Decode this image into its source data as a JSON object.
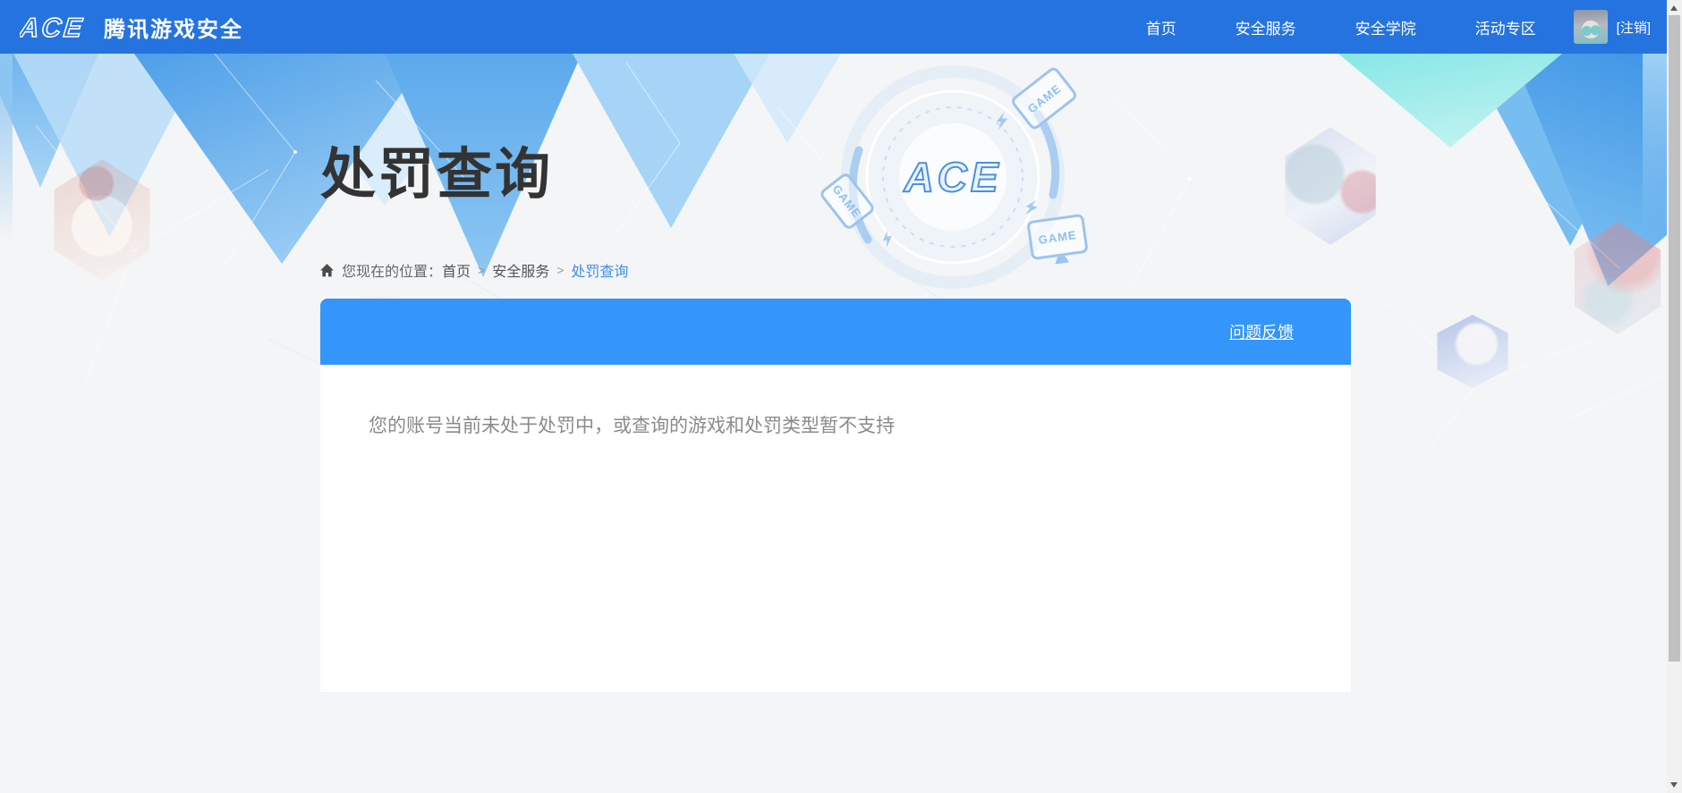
{
  "navbar": {
    "brand": {
      "logo_text": "ACE",
      "name": "腾讯游戏安全"
    },
    "items": [
      {
        "label": "首页"
      },
      {
        "label": "安全服务"
      },
      {
        "label": "安全学院"
      },
      {
        "label": "活动专区"
      }
    ],
    "logout_label": "[注销]"
  },
  "hero": {
    "title": "处罚查询",
    "emblem_text": "ACE",
    "game_icon_label": "GAME"
  },
  "breadcrumb": {
    "prefix": "您现在的位置：",
    "separator": ">",
    "items": [
      {
        "label": "首页"
      },
      {
        "label": "安全服务"
      },
      {
        "label": "处罚查询"
      }
    ]
  },
  "panel": {
    "feedback_link": "问题反馈",
    "message": "您的账号当前未处于处罚中，或查询的游戏和处罚类型暂不支持"
  },
  "icons": {
    "brand_logo": "ACE-wordmark",
    "home_icon": "house",
    "user_avatar": "anime-portrait",
    "game_device_icons": "tablet-and-monitor",
    "scroll_up_icon": "triangle-up",
    "scroll_down_icon": "triangle-down"
  },
  "colors": {
    "navbar_bg": "#2573DF",
    "panel_header_bg": "#3495FA",
    "hero_shard_blue": "#4e9fe8",
    "hero_shard_cyan": "#86e7e6",
    "breadcrumb_active": "#3E8EE9",
    "title_text": "#333333",
    "message_text": "#8A8A8A"
  }
}
